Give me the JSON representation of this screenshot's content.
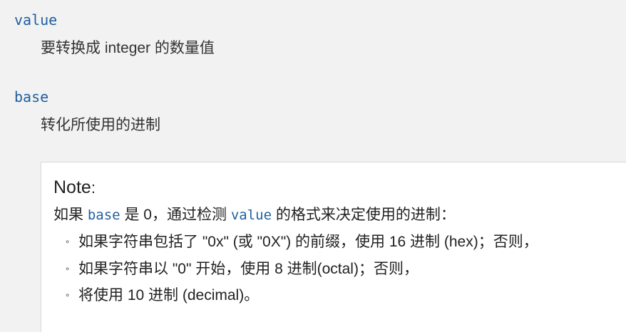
{
  "params": [
    {
      "name": "value",
      "description": "要转换成 integer 的数量值"
    },
    {
      "name": "base",
      "description": "转化所使用的进制"
    }
  ],
  "note": {
    "title": "Note",
    "title_colon": ":",
    "intro_prefix": "如果",
    "intro_code1": "base",
    "intro_mid": "是 0，通过检测",
    "intro_code2": "value",
    "intro_suffix": "的格式来决定使用的进制：",
    "bullet_marker": "◦",
    "bullets": [
      "如果字符串包括了 \"0x\" (或 \"0X\") 的前缀，使用 16 进制 (hex)；否则，",
      "如果字符串以 \"0\" 开始，使用 8 进制(octal)；否则，",
      "将使用 10 进制 (decimal)。"
    ]
  }
}
